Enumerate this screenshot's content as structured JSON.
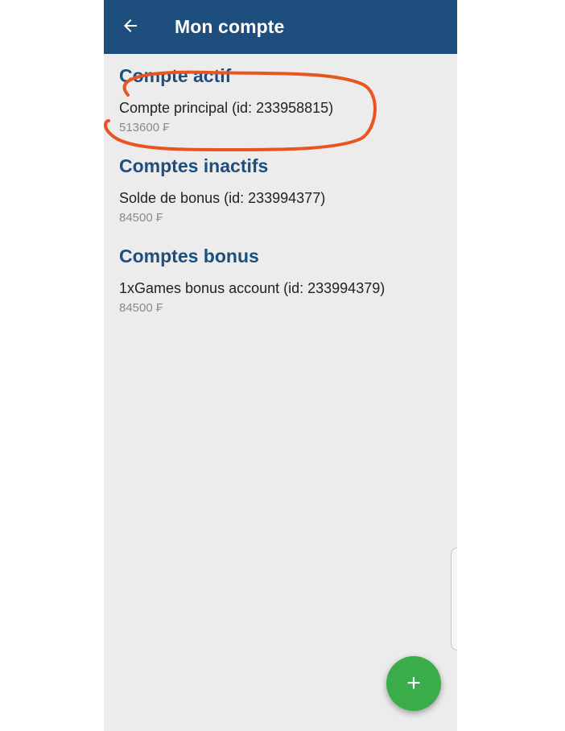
{
  "appbar": {
    "title": "Mon compte",
    "back_icon": "arrow-left-icon"
  },
  "sections": [
    {
      "title": "Compte actif",
      "accounts": [
        {
          "name": "Compte principal (id: 233958815)",
          "balance": "513600 ₣"
        }
      ]
    },
    {
      "title": "Comptes inactifs",
      "accounts": [
        {
          "name": "Solde de bonus (id: 233994377)",
          "balance": "84500 ₣"
        }
      ]
    },
    {
      "title": "Comptes bonus",
      "accounts": [
        {
          "name": "1xGames bonus account (id: 233994379)",
          "balance": "84500 ₣"
        }
      ]
    }
  ],
  "fab": {
    "icon": "plus-icon",
    "label": "+"
  },
  "colors": {
    "primary": "#1d4e7e",
    "background": "#ececec",
    "fab": "#3aad4a",
    "annotation": "#e8551e"
  }
}
